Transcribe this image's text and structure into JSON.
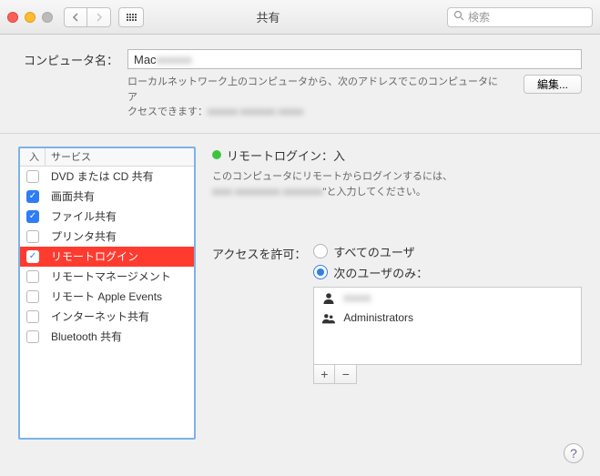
{
  "titlebar": {
    "title": "共有",
    "search_placeholder": "検索"
  },
  "computer": {
    "label": "コンピュータ名：",
    "value_prefix": "       Mac",
    "value_blur": "xxxxxx",
    "desc_line1": "ローカルネットワーク上のコンピュータから、次のアドレスでこのコンピュータにア",
    "desc_line2_a": "クセスできます：",
    "desc_line2_b": "xxxxxx xxxxxxx xxxxx",
    "edit_label": "編集..."
  },
  "services": {
    "col_on": "入",
    "col_name": "サービス",
    "items": [
      {
        "on": false,
        "name": "DVD または CD 共有"
      },
      {
        "on": true,
        "name": "画面共有"
      },
      {
        "on": true,
        "name": "ファイル共有"
      },
      {
        "on": false,
        "name": "プリンタ共有"
      },
      {
        "on": true,
        "name": "リモートログイン",
        "selected": true
      },
      {
        "on": false,
        "name": "リモートマネージメント"
      },
      {
        "on": false,
        "name": "リモート Apple Events"
      },
      {
        "on": false,
        "name": "インターネット共有"
      },
      {
        "on": false,
        "name": "Bluetooth 共有"
      }
    ]
  },
  "detail": {
    "status": "リモートログイン：入",
    "instr1": "このコンピュータにリモートからログインするには、",
    "instr2_blur": "xxxx xxxxxxxxx xxxxxxxx",
    "instr2_tail": "\"と入力してください。",
    "access_label": "アクセスを許可：",
    "radio_all": "すべてのユーザ",
    "radio_only": "次のユーザのみ：",
    "users": [
      {
        "name_blur": "xxxxx",
        "icon": "single"
      },
      {
        "name": "Administrators",
        "icon": "group"
      }
    ]
  }
}
